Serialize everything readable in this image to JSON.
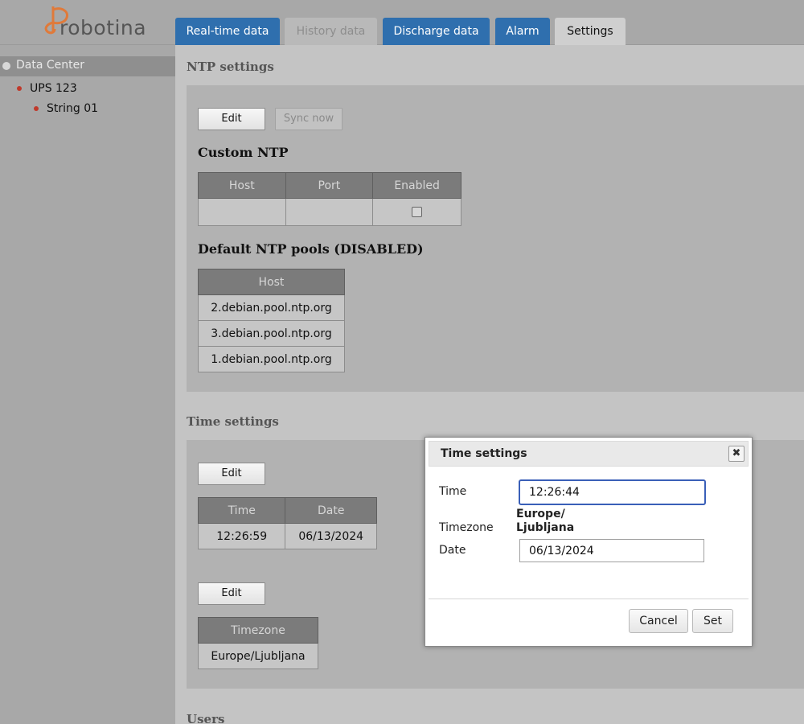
{
  "brand": {
    "name": "robotina",
    "accent": "#e07a3a"
  },
  "tabs": [
    {
      "label": "Real-time data",
      "state": "normal"
    },
    {
      "label": "History data",
      "state": "disabled"
    },
    {
      "label": "Discharge data",
      "state": "normal"
    },
    {
      "label": "Alarm",
      "state": "normal"
    },
    {
      "label": "Settings",
      "state": "active"
    }
  ],
  "sidebar": {
    "root": "Data Center",
    "items": [
      {
        "label": "UPS 123",
        "level": 1
      },
      {
        "label": "String 01",
        "level": 2
      }
    ]
  },
  "ntp": {
    "title": "NTP settings",
    "edit_label": "Edit",
    "sync_label": "Sync now",
    "custom_title": "Custom NTP",
    "custom_headers": [
      "Host",
      "Port",
      "Enabled"
    ],
    "custom_row": {
      "host": "",
      "port": "",
      "enabled": false
    },
    "default_title": "Default NTP pools (DISABLED)",
    "default_header": "Host",
    "default_hosts": [
      "2.debian.pool.ntp.org",
      "3.debian.pool.ntp.org",
      "1.debian.pool.ntp.org"
    ]
  },
  "time": {
    "title": "Time settings",
    "edit_label": "Edit",
    "headers": [
      "Time",
      "Date"
    ],
    "row": {
      "time": "12:26:59",
      "date": "06/13/2024"
    },
    "edit2_label": "Edit",
    "tz_header": "Timezone",
    "tz_value": "Europe/Ljubljana"
  },
  "users": {
    "title": "Users"
  },
  "dialog": {
    "title": "Time settings",
    "close_glyph": "✖",
    "time_label": "Time",
    "time_value": "12:26:44",
    "timezone_label": "Timezone",
    "timezone_line1": "Europe/",
    "timezone_line2": "Ljubljana",
    "date_label": "Date",
    "date_value": "06/13/2024",
    "cancel_label": "Cancel",
    "set_label": "Set"
  }
}
